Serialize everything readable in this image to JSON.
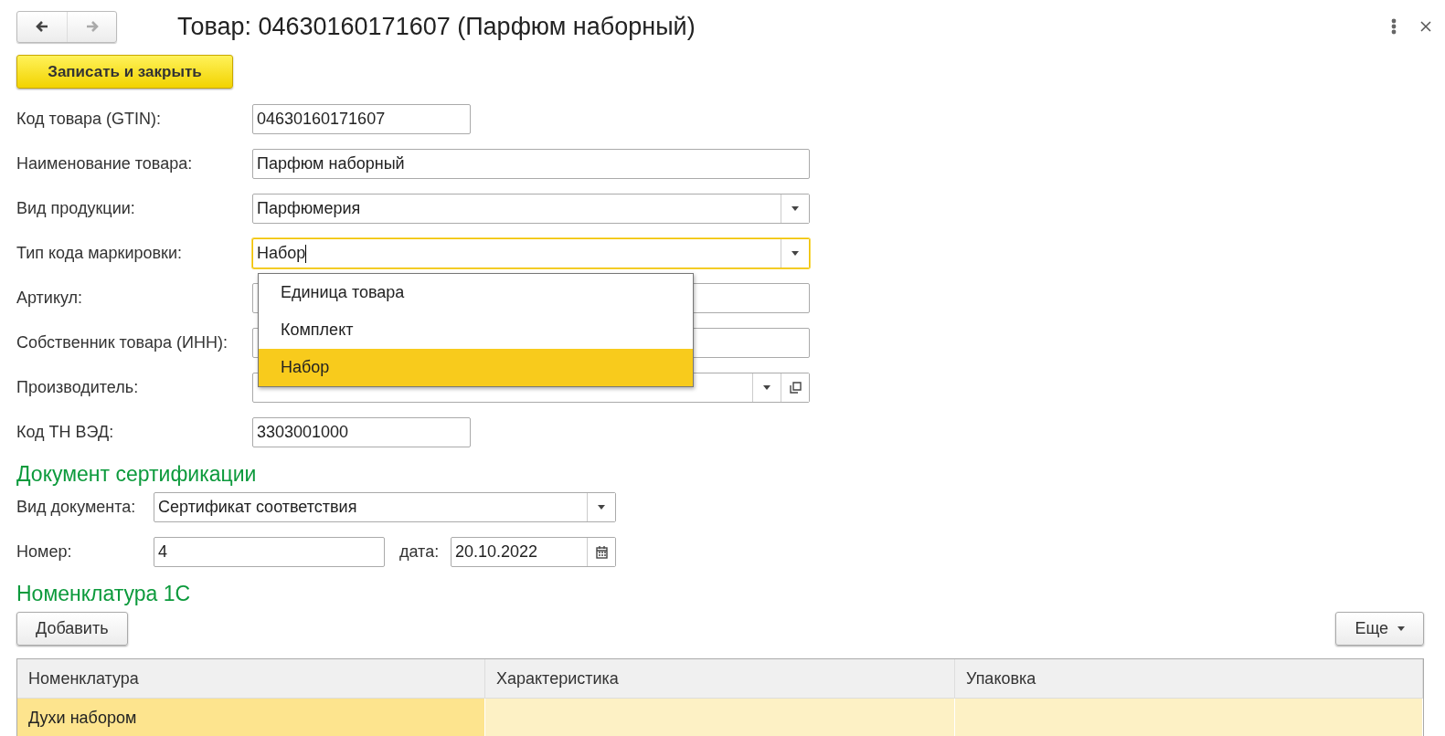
{
  "header": {
    "nav": [
      {
        "kind": "back",
        "disabled": false
      },
      {
        "kind": "forward",
        "disabled": true
      }
    ],
    "title": "Товар: 04630160171607 (Парфюм наборный)"
  },
  "toolbar": {
    "save_button": "Записать и закрыть"
  },
  "fields": [
    {
      "label": "Код товара (GTIN):",
      "value": "04630160171607",
      "kind": "short_text",
      "focused": false
    },
    {
      "label": "Наименование товара:",
      "value": "Парфюм наборный",
      "kind": "text",
      "focused": false
    },
    {
      "label": "Вид продукции:",
      "value": "Парфюмерия",
      "kind": "select",
      "focused": false
    },
    {
      "label": "Тип кода маркировки:",
      "value": "Набор",
      "kind": "select",
      "focused": true,
      "options": [
        {
          "label": "Единица товара",
          "selected": false
        },
        {
          "label": "Комплект",
          "selected": false
        },
        {
          "label": "Набор",
          "selected": true
        }
      ]
    },
    {
      "label": "Артикул:",
      "kind": "text",
      "focused": false
    },
    {
      "label": "Собственник товара (ИНН):",
      "kind": "text",
      "focused": false
    },
    {
      "label": "Производитель:",
      "kind": "select_link",
      "focused": false
    },
    {
      "label": "Код ТН ВЭД:",
      "value": "3303001000",
      "kind": "short_text",
      "focused": false
    }
  ],
  "certificate": {
    "heading": "Документ сертификации",
    "doc_type": {
      "label": "Вид документа:",
      "value": "Сертификат соответствия"
    },
    "number": {
      "label": "Номер:",
      "value": "4"
    },
    "date": {
      "label": "дата:",
      "value": "20.10.2022"
    }
  },
  "nomenclature": {
    "heading": "Номенклатура 1С",
    "add_button": "Добавить",
    "more_button": "Еще",
    "table": {
      "columns": [
        "Номенклатура",
        "Характеристика",
        "Упаковка"
      ],
      "rows": [
        {
          "nomenclature": "Духи набором",
          "selected": true
        }
      ]
    }
  }
}
